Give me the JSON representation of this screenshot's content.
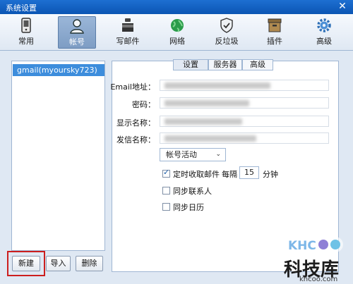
{
  "window": {
    "title": "系统设置"
  },
  "toolbar": {
    "items": [
      {
        "label": "常用",
        "icon": "phone-icon"
      },
      {
        "label": "帐号",
        "icon": "user-icon",
        "active": true
      },
      {
        "label": "写邮件",
        "icon": "ink-bottle-icon"
      },
      {
        "label": "网络",
        "icon": "globe-icon"
      },
      {
        "label": "反垃圾",
        "icon": "shield-icon"
      },
      {
        "label": "插件",
        "icon": "box-icon"
      },
      {
        "label": "高级",
        "icon": "gear-icon"
      }
    ]
  },
  "accounts": {
    "items": [
      "gmail(myoursky723)"
    ]
  },
  "buttons": {
    "new": "新建",
    "import": "导入",
    "delete": "删除"
  },
  "tabs": {
    "settings": "设置",
    "server": "服务器",
    "advanced": "高级"
  },
  "form": {
    "email_label": "Email地址：",
    "password_label": "密码：",
    "display_name_label": "显示名称：",
    "sender_name_label": "发信名称："
  },
  "account_activity": {
    "selected": "帐号活动"
  },
  "options": {
    "auto_fetch_label": "定时收取邮件",
    "auto_fetch_checked": true,
    "every_label": "每隔",
    "interval_value": "15",
    "minutes_label": "分钟",
    "sync_contacts_label": "同步联系人",
    "sync_contacts_checked": false,
    "sync_calendar_label": "同步日历",
    "sync_calendar_checked": false
  },
  "watermark": {
    "logo_text": "KHCOO",
    "name": "科技库",
    "url": "khcoo.com"
  },
  "colors": {
    "accent": "#3d8ddc",
    "titlebar": "#0b55b4",
    "highlight": "#cc1f1f"
  }
}
